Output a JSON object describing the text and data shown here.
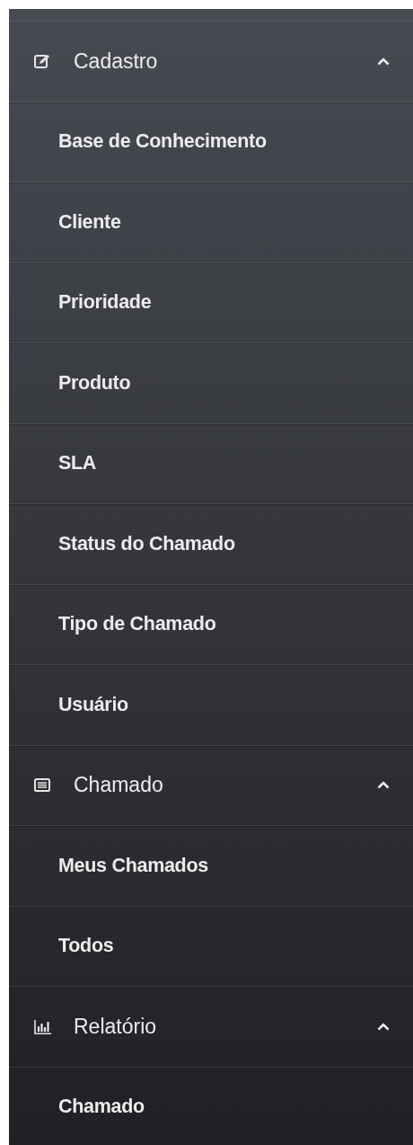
{
  "menu": [
    {
      "label": "Cadastro",
      "expanded": true,
      "children": [
        {
          "label": "Base de Conhecimento"
        },
        {
          "label": "Cliente"
        },
        {
          "label": "Prioridade"
        },
        {
          "label": "Produto"
        },
        {
          "label": "SLA"
        },
        {
          "label": "Status do Chamado"
        },
        {
          "label": "Tipo de Chamado"
        },
        {
          "label": "Usuário"
        }
      ]
    },
    {
      "label": "Chamado",
      "expanded": true,
      "children": [
        {
          "label": "Meus Chamados"
        },
        {
          "label": "Todos"
        }
      ]
    },
    {
      "label": "Relatório",
      "expanded": true,
      "children": [
        {
          "label": "Chamado"
        }
      ]
    }
  ]
}
